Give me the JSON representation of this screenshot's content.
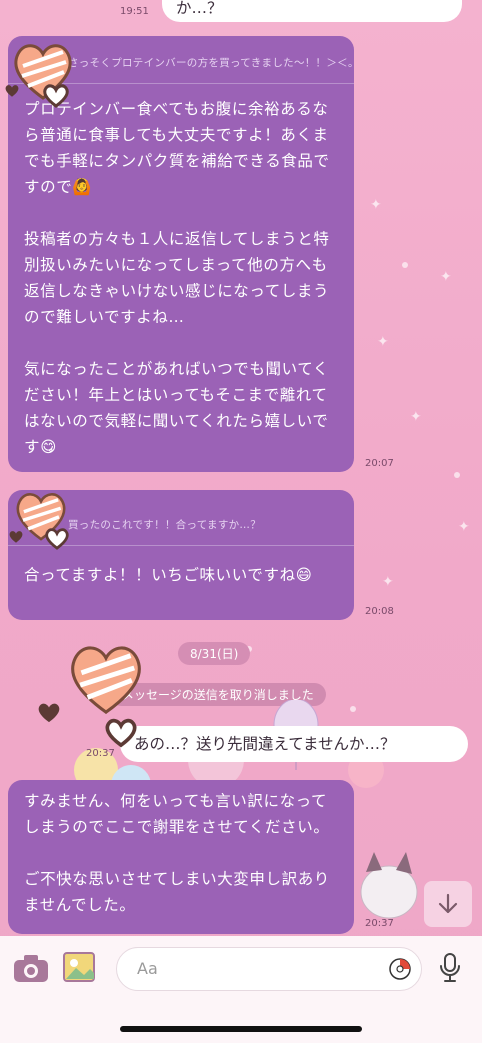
{
  "top_message": {
    "time": "19:51",
    "text": "か…？"
  },
  "messages": [
    {
      "reply_to": "さっそくプロテインバーの方を買ってきました〜！！＞＜。多分これですよね…？違うの…",
      "body": "プロテインバー食べてもお腹に余裕あるなら普通に食事しても大丈夫ですよ！あくまでも手軽にタンパク質を補給できる食品ですので🙆\n\n投稿者の方々も１人に返信してしまうと特別扱いみたいになってしまって他の方へも返信しなきゃいけない感じになってしまうので難しいですよね…\n\n気になったことがあればいつでも聞いてください！年上とはいってもそこまで離れてはないので気軽に聞いてくれたら嬉しいです😋",
      "time": "20:07"
    },
    {
      "reply_to": "買ったのこれです！！合ってますか…？",
      "body": "合ってますよ！！いちご味いいですね😄",
      "time": "20:08"
    }
  ],
  "date_divider": "8/31(日)",
  "system_notice": "メッセージの送信を取り消しました",
  "sent_message": {
    "text": "あの…？送り先間違えてませんか…？",
    "time": "20:37"
  },
  "last_message": {
    "body": "すみません、何をいっても言い訳になってしまうのでここで謝罪をさせてください。\n\nご不快な思いさせてしまい大変申し訳ありませんでした。",
    "time": "20:37"
  },
  "input": {
    "placeholder": "Aa"
  },
  "icons": [
    "camera-icon",
    "photo-icon",
    "emoji-icon",
    "mic-icon",
    "scroll-down-icon"
  ],
  "colors": {
    "bubble": "#9b62b6",
    "background": "#f4b2cf"
  }
}
